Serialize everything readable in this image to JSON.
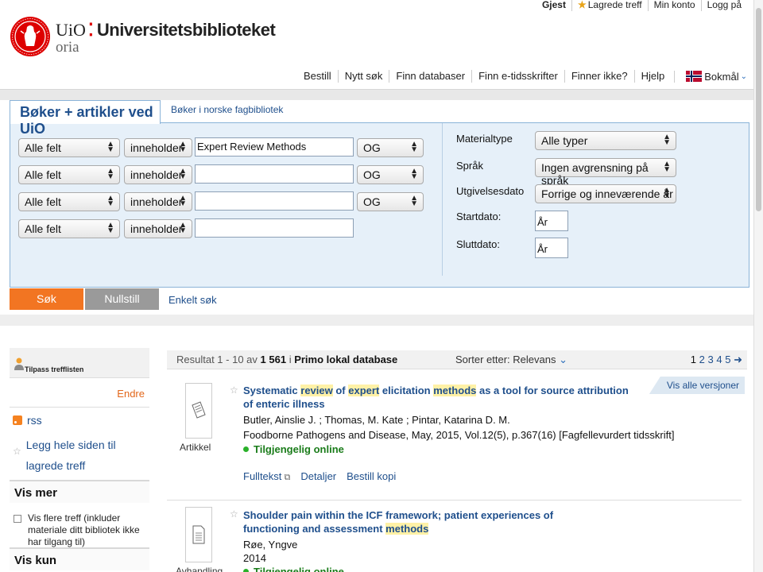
{
  "top": {
    "guest": "Gjest",
    "saved": "Lagrede treff",
    "account": "Min konto",
    "login": "Logg på"
  },
  "logo": {
    "uio": "UiO",
    "library": "Universitetsbiblioteket",
    "oria": "oria",
    "accent": "#dd0000"
  },
  "nav": {
    "items": [
      "Bestill",
      "Nytt søk",
      "Finn databaser",
      "Finn e-tidsskrifter",
      "Finner ikke?",
      "Hjelp"
    ],
    "language": "Bokmål"
  },
  "tabs": {
    "active": "Bøker + artikler ved UiO",
    "other": "Bøker i norske fagbibliotek"
  },
  "search": {
    "rows": [
      {
        "field": "Alle felt",
        "op": "inneholder",
        "value": "Expert Review Methods",
        "bool": "OG"
      },
      {
        "field": "Alle felt",
        "op": "inneholder",
        "value": "",
        "bool": "OG"
      },
      {
        "field": "Alle felt",
        "op": "inneholder",
        "value": "",
        "bool": "OG"
      },
      {
        "field": "Alle felt",
        "op": "inneholder",
        "value": "",
        "bool": ""
      }
    ],
    "filters": {
      "material_label": "Materialtype",
      "material_value": "Alle typer",
      "language_label": "Språk",
      "language_value": "Ingen avgrensning på språk",
      "pubdate_label": "Utgivelsesdato",
      "pubdate_value": "Forrige og inneværende år",
      "start_label": "Startdato:",
      "start_placeholder": "År",
      "end_label": "Sluttdato:",
      "end_placeholder": "År"
    },
    "search_button": "Søk",
    "reset_button": "Nullstill",
    "simple_link": "Enkelt søk"
  },
  "sidebar": {
    "tailor": "Tilpass trefflisten",
    "edit": "Endre",
    "rss": "rss",
    "save_page": "Legg hele siden til lagrede treff",
    "more_title": "Vis mer",
    "more_option": "Vis flere treff (inkluder materiale ditt bibliotek ikke har tilgang til)",
    "only_title": "Vis kun"
  },
  "results": {
    "range": "Resultat 1 - 10 av",
    "total": "1 561",
    "source_prefix": "i",
    "source": "Primo lokal database",
    "sort_label": "Sorter etter:",
    "sort_value": "Relevans",
    "pages": [
      "1",
      "2",
      "3",
      "4",
      "5"
    ],
    "versions": "Vis alle versjoner",
    "records": [
      {
        "type": "Artikkel",
        "title_parts": [
          "Systematic ",
          "review",
          " of ",
          "expert",
          " elicitation ",
          "methods",
          " as a tool for source attribution of enteric illness"
        ],
        "authors": "Butler, Ainslie J. ; Thomas, M. Kate ; Pintar, Katarina D. M.",
        "source": "Foodborne Pathogens and Disease, May, 2015, Vol.12(5), p.367(16) [Fagfellevurdert tidsskrift]",
        "availability": "Tilgjengelig online",
        "links": [
          "Fulltekst",
          "Detaljer",
          "Bestill kopi"
        ]
      },
      {
        "type": "Avhandling",
        "title_parts": [
          "Shoulder pain within the ICF framework; patient experiences of functioning and assessment ",
          "methods"
        ],
        "authors": "Røe, Yngve",
        "source": "2014",
        "availability": "Tilgjengelig online"
      }
    ]
  }
}
